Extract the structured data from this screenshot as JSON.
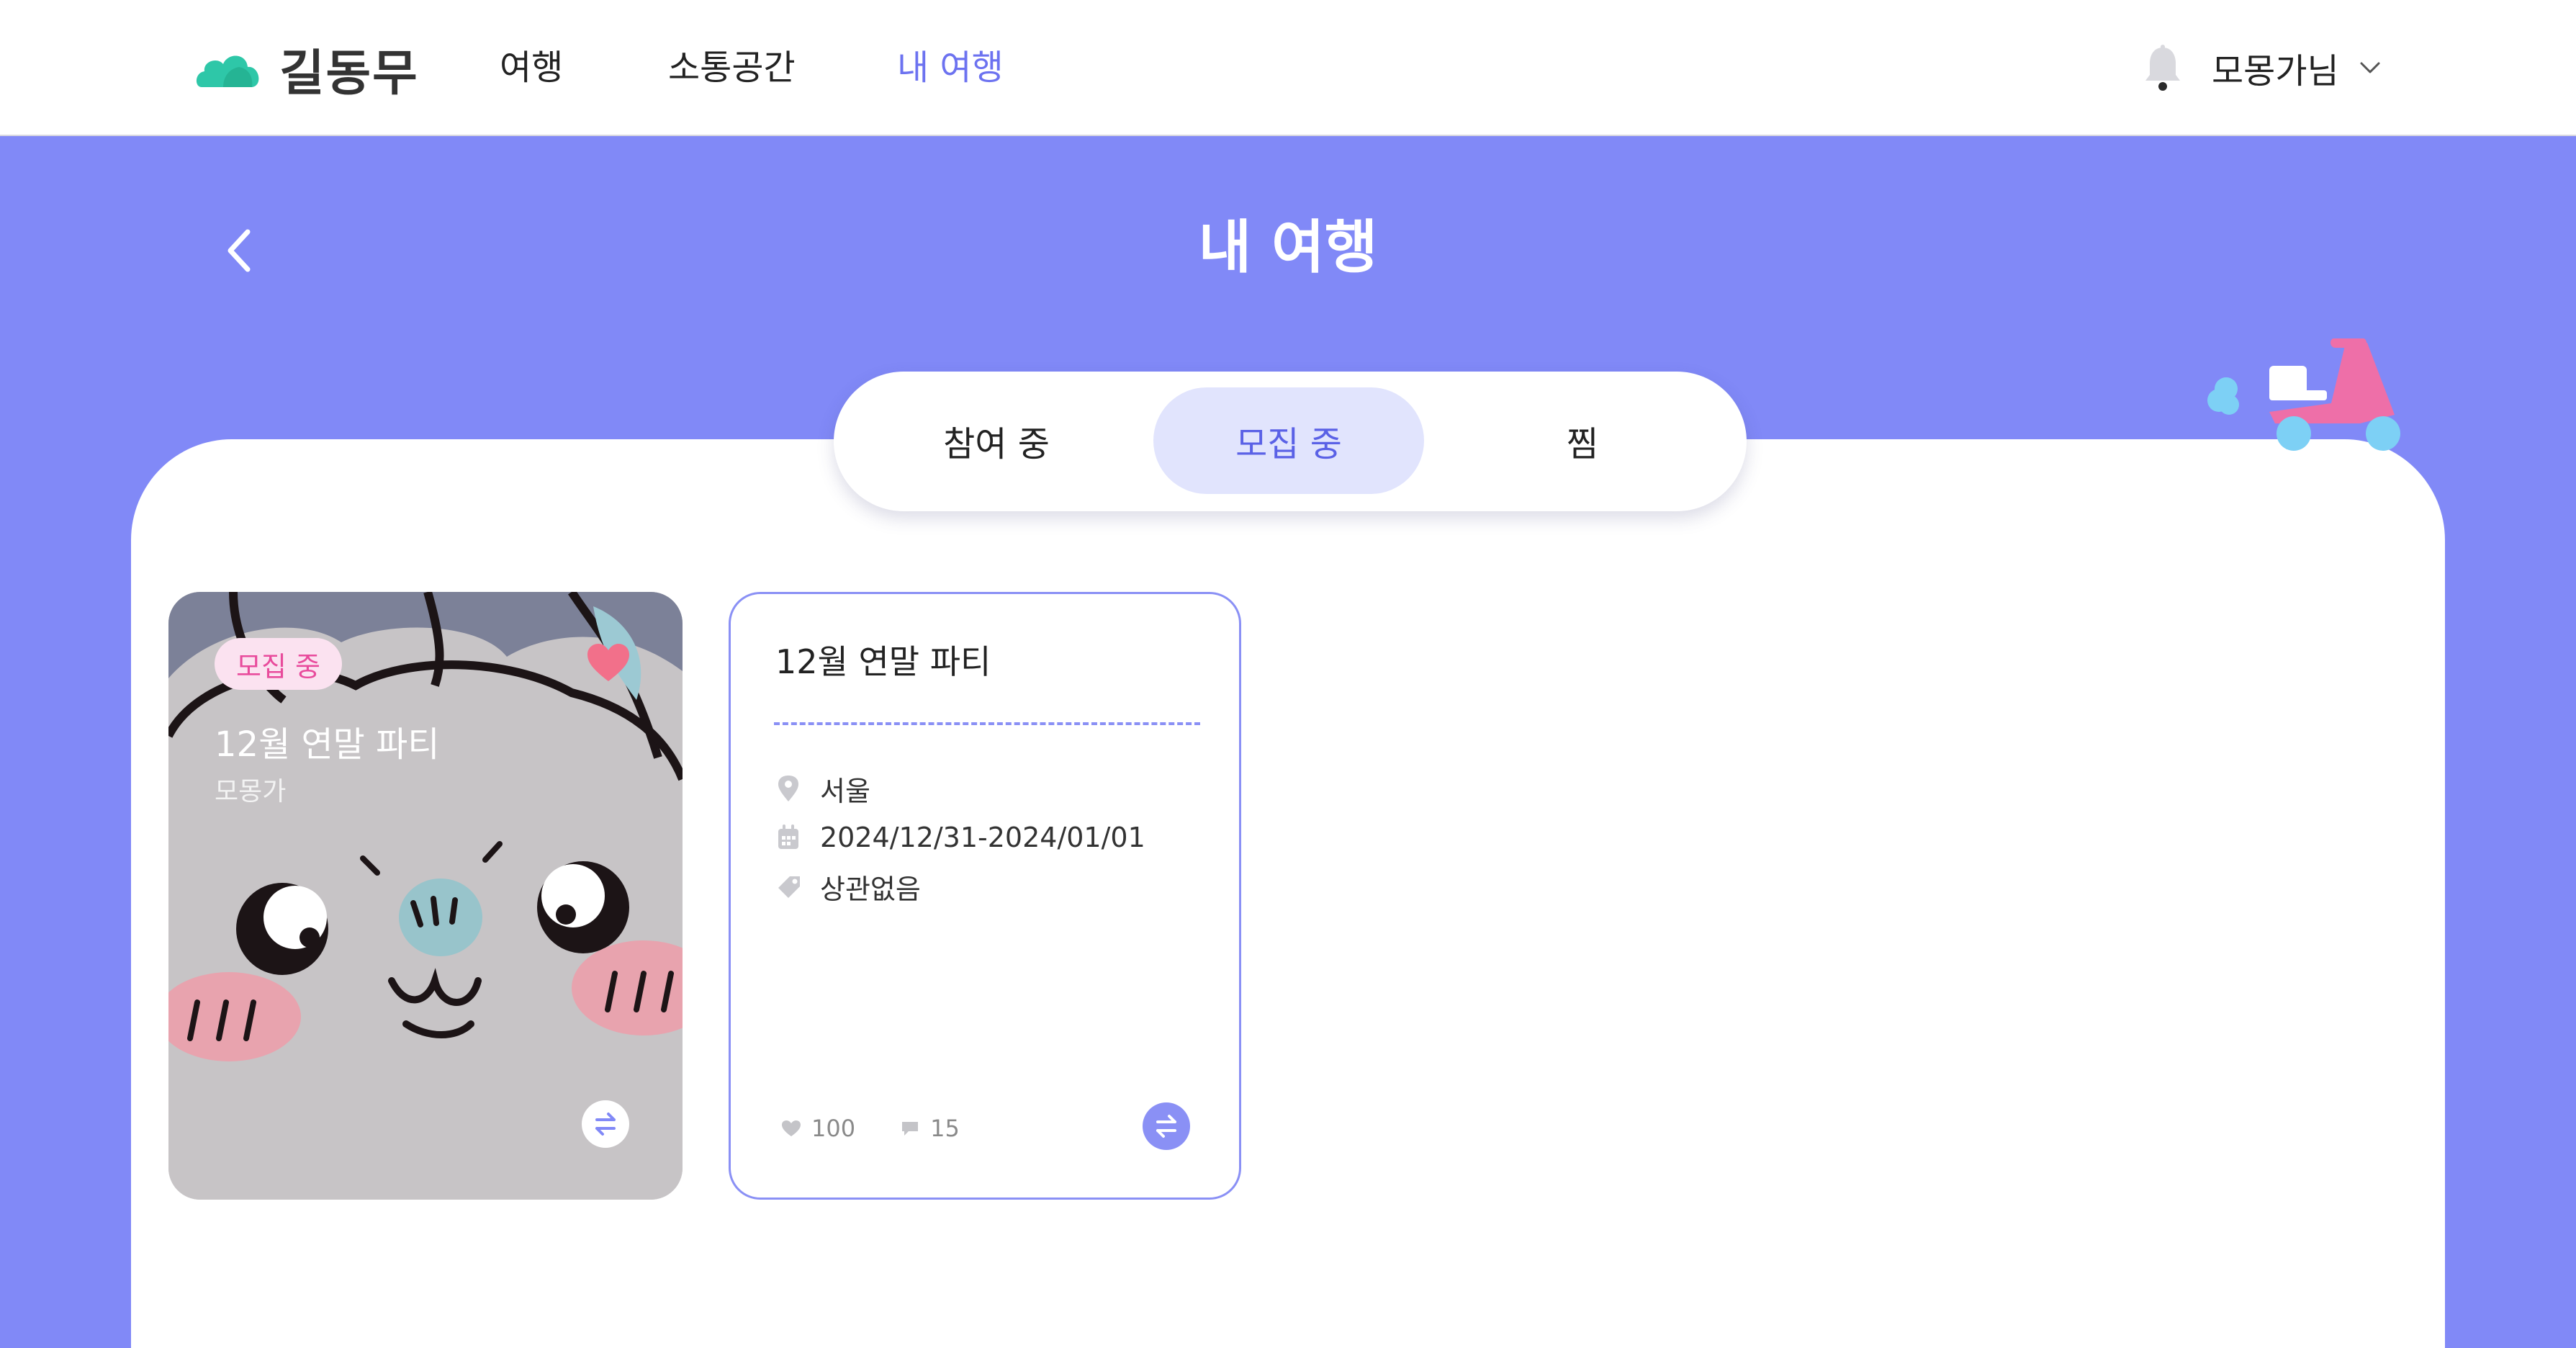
{
  "brand": {
    "name": "길동무"
  },
  "nav": {
    "items": [
      {
        "label": "여행"
      },
      {
        "label": "소통공간"
      },
      {
        "label": "내 여행"
      }
    ],
    "active_index": 2
  },
  "user": {
    "name": "모몽가님"
  },
  "page": {
    "title": "내 여행"
  },
  "tabs": {
    "items": [
      {
        "label": "참여 중"
      },
      {
        "label": "모집 중"
      },
      {
        "label": "찜"
      }
    ],
    "active_index": 1
  },
  "cards": [
    {
      "type": "image",
      "badge": "모집 중",
      "title": "12월 연말 파티",
      "author": "모몽가",
      "liked": true
    },
    {
      "type": "info",
      "title": "12월 연말 파티",
      "location": "서울",
      "dates": "2024/12/31-2024/01/01",
      "tag": "상관없음",
      "likes": "100",
      "comments": "15"
    }
  ],
  "colors": {
    "accent": "#8189F7",
    "accent_dark": "#5A61E6",
    "tab_active_bg": "#E1E4FD",
    "badge_text": "#E84B9C",
    "badge_bg": "#FBE2F0",
    "heart": "#F2708A",
    "logo": "#2EC7A8"
  },
  "icons": {
    "logo": "cloud-logo-icon",
    "notifications": "bell-icon",
    "user_menu": "chevron-down-icon",
    "back": "chevron-left-icon",
    "like": "heart-icon",
    "switch": "swap-arrows-icon",
    "location": "map-pin-icon",
    "date": "calendar-icon",
    "tag": "tag-icon",
    "comments": "comment-icon"
  }
}
